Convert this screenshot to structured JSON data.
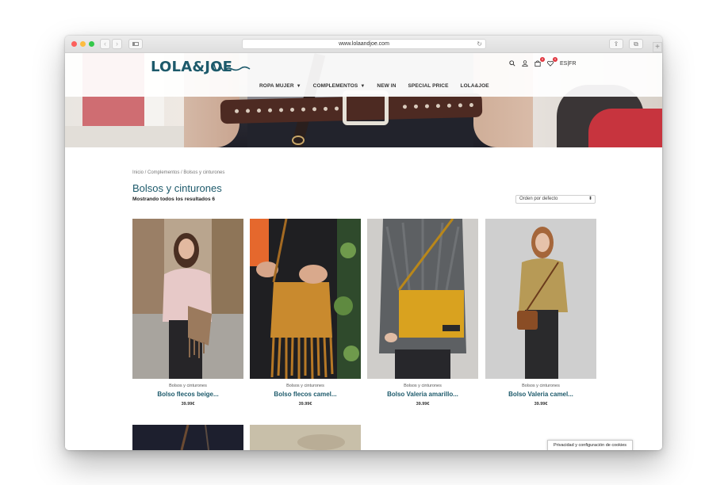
{
  "browser": {
    "url": "www.lolaandjoe.com"
  },
  "site": {
    "logo_text": "LOLA&JOE",
    "cart_badge": "0",
    "wishlist_badge": "0",
    "lang_es": "ES",
    "lang_sep": "|",
    "lang_fr": "FR",
    "menu": [
      {
        "label": "ROPA MUJER",
        "has_dropdown": true
      },
      {
        "label": "COMPLEMENTOS",
        "has_dropdown": true
      },
      {
        "label": "NEW IN",
        "has_dropdown": false
      },
      {
        "label": "SPECIAL PRICE",
        "has_dropdown": false
      },
      {
        "label": "LOLA&JOE",
        "has_dropdown": false
      }
    ]
  },
  "main": {
    "breadcrumb": "Inicio / Complementos / Bolsos y cinturones",
    "title": "Bolsos y cinturones",
    "result_count": "Mostrando todos los resultados 6",
    "sort_selected": "Orden por defecto",
    "products": [
      {
        "category": "Bolsos y cinturones",
        "name": "Bolso flecos beige...",
        "price": "39.99€"
      },
      {
        "category": "Bolsos y cinturones",
        "name": "Bolso flecos camel...",
        "price": "39.99€"
      },
      {
        "category": "Bolsos y cinturones",
        "name": "Bolso Valeria amarillo...",
        "price": "39.99€"
      },
      {
        "category": "Bolsos y cinturones",
        "name": "Bolso Valeria camel...",
        "price": "39.99€"
      }
    ]
  },
  "cookie_tab": "Privacidad y configuración de cookies",
  "colors": {
    "brand": "#1d5a6b",
    "badge": "#e0323c"
  }
}
